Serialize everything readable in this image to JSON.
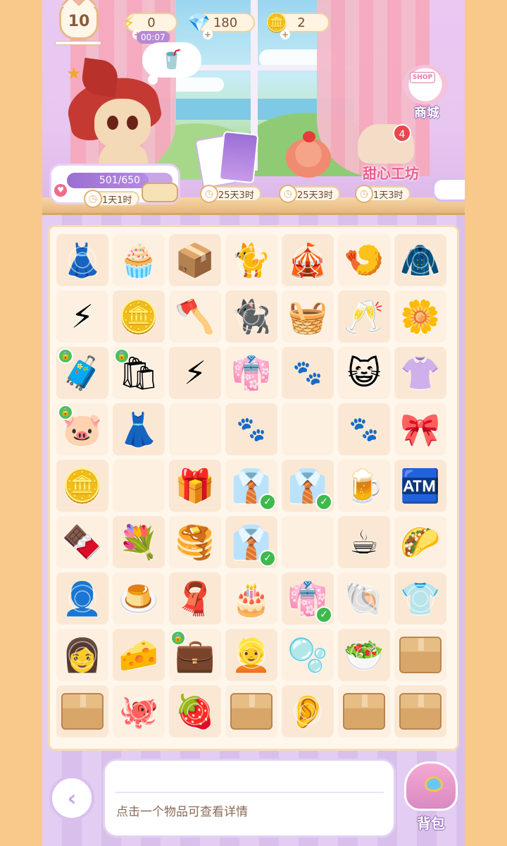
{
  "resources": {
    "level": "10",
    "energy": "0",
    "energy_timer": "00:07",
    "gems": "180",
    "coins": "2"
  },
  "character": {
    "thought_item": "🥤",
    "energy_progress_text": "501/650",
    "energy_progress_fraction": 0.77,
    "energy_timer": "1天1时"
  },
  "orders": [
    {
      "icon": "card-pack",
      "timer": "25天3时"
    },
    {
      "icon": "strawberry-roll-cake",
      "timer": "25天3时"
    },
    {
      "icon": "sweet-workshop",
      "label": "甜心工坊",
      "timer": "1天3时",
      "badge": "4"
    }
  ],
  "shop": {
    "tag": "SHOP",
    "label": "商城"
  },
  "grid": {
    "rows": [
      [
        {
          "icon": "👗",
          "web": true
        },
        {
          "icon": "🧁",
          "web": false
        },
        {
          "icon": "📦",
          "web": false
        },
        {
          "icon": "🐈",
          "web": true
        },
        {
          "icon": "🎪",
          "web": true
        },
        {
          "icon": "🍤",
          "web": false
        },
        {
          "icon": "🧥",
          "web": true
        }
      ],
      [
        {
          "icon": "⚡",
          "web": false
        },
        {
          "icon": "🪙",
          "web": false
        },
        {
          "icon": "🪓",
          "web": false
        },
        {
          "icon": "🐈‍⬛",
          "web": true
        },
        {
          "icon": "🧺",
          "web": false
        },
        {
          "icon": "🥂",
          "web": false
        },
        {
          "icon": "🌼",
          "web": false
        }
      ],
      [
        {
          "icon": "🧳",
          "lock": true
        },
        {
          "icon": "🛍",
          "lock": true
        },
        {
          "icon": "⚡"
        },
        {
          "icon": "👘"
        },
        {
          "paw": true
        },
        {
          "icon": "😺"
        },
        {
          "icon": "👚"
        }
      ],
      [
        {
          "icon": "🐷",
          "lock": true
        },
        {
          "icon": "👗"
        },
        {
          "empty": true
        },
        {
          "paw": true
        },
        {
          "empty": true
        },
        {
          "paw": true
        },
        {
          "icon": "🎀"
        }
      ],
      [
        {
          "icon": "🪙"
        },
        {
          "empty": true
        },
        {
          "icon": "🎁"
        },
        {
          "icon": "👔",
          "check": true
        },
        {
          "icon": "👔",
          "check": true
        },
        {
          "icon": "🍺"
        },
        {
          "icon": "🏧"
        }
      ],
      [
        {
          "icon": "🍫"
        },
        {
          "icon": "💐"
        },
        {
          "icon": "🥞"
        },
        {
          "icon": "👔",
          "check": true
        },
        {
          "empty": true
        },
        {
          "icon": "☕"
        },
        {
          "icon": "🌮"
        }
      ],
      [
        {
          "icon": "👤",
          "web": true
        },
        {
          "icon": "🍮"
        },
        {
          "icon": "🧣"
        },
        {
          "icon": "🎂"
        },
        {
          "icon": "👘",
          "check": true
        },
        {
          "icon": "🐚",
          "web": true
        },
        {
          "icon": "👕",
          "web": true
        }
      ],
      [
        {
          "icon": "👩",
          "web": true
        },
        {
          "icon": "🧀"
        },
        {
          "icon": "💼",
          "lock": true
        },
        {
          "icon": "👱",
          "web": true
        },
        {
          "icon": "🫧"
        },
        {
          "icon": "🥗",
          "web": true
        },
        {
          "box": true
        }
      ],
      [
        {
          "box": true
        },
        {
          "icon": "🐙",
          "web": true
        },
        {
          "icon": "🍓",
          "web": true
        },
        {
          "box": true
        },
        {
          "icon": "👂",
          "web": true
        },
        {
          "box": true
        },
        {
          "box": true
        }
      ]
    ]
  },
  "bottom": {
    "back_label": "‹",
    "info_text": "点击一个物品可查看详情",
    "bag_label": "背包"
  }
}
